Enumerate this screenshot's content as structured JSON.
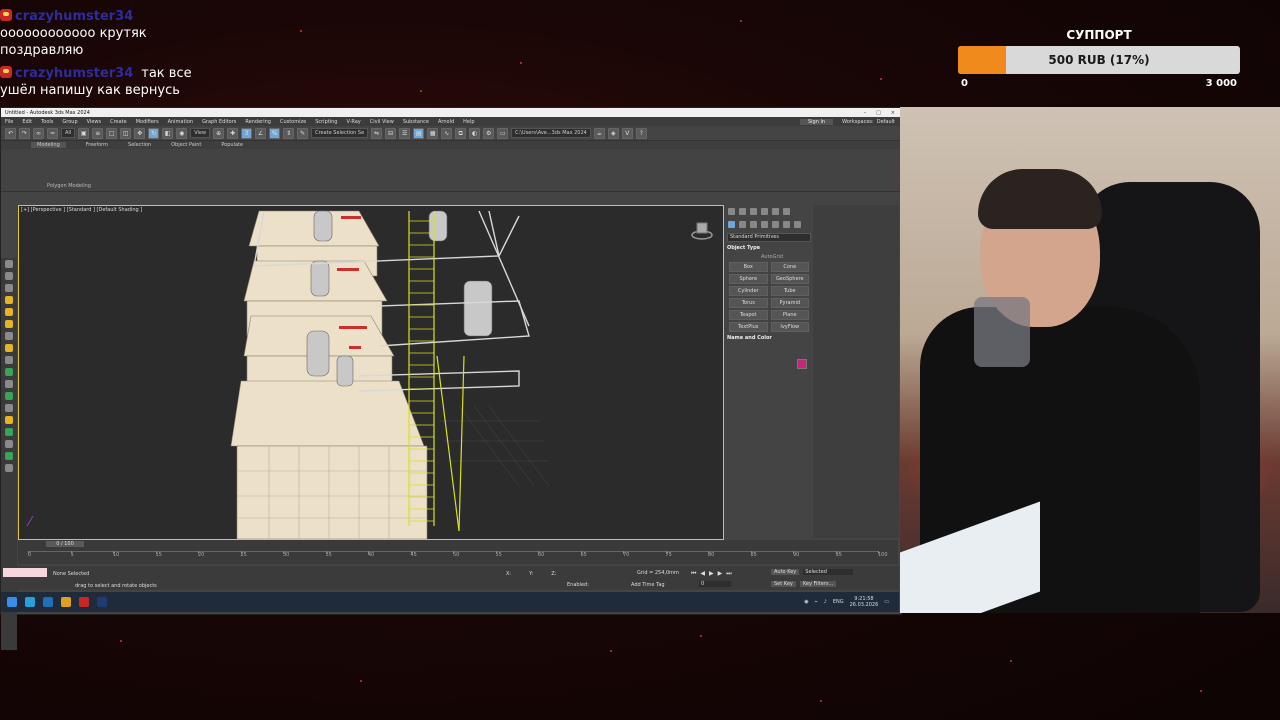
{
  "chat": [
    {
      "user": "crazyhumster34",
      "lines": [
        "оооооооооооо крутяк",
        "поздравляю"
      ]
    },
    {
      "user": "crazyhumster34",
      "inline": "так все",
      "lines": [
        "ушёл напишу как вернусь"
      ]
    }
  ],
  "support_goal": {
    "title": "СУППОРТ",
    "label": "500 RUB (17%)",
    "progress": 0.17,
    "min": "0",
    "max": "3 000",
    "fill_color": "#f08a1c"
  },
  "app": {
    "title": "Untitled - Autodesk 3ds Max 2024",
    "menu": [
      "File",
      "Edit",
      "Tools",
      "Group",
      "Views",
      "Create",
      "Modifiers",
      "Animation",
      "Graph Editors",
      "Rendering",
      "Customize",
      "Scripting",
      "V-Ray",
      "Civil View",
      "Substance",
      "Arnold",
      "Help"
    ],
    "sign_in": "Sign In",
    "workspaces_label": "Workspaces:",
    "workspace": "Default",
    "toolbar": {
      "filter": "All",
      "view": "View",
      "selection_set": "Create Selection Se",
      "path": "C:\\Users\\Ave...3ds Max 2024"
    },
    "ribbon_tabs": [
      "Modeling",
      "Freeform",
      "Selection",
      "Object Paint",
      "Populate"
    ],
    "ribbon_label": "Polygon Modeling",
    "viewport_label": "[+] [Perspective ] [Standard ] [Default Shading ]",
    "command_panel": {
      "category": "Standard Primitives",
      "object_type_title": "Object Type",
      "autogrid": "AutoGrid",
      "buttons": [
        "Box",
        "Cone",
        "Sphere",
        "GeoSphere",
        "Cylinder",
        "Tube",
        "Torus",
        "Pyramid",
        "Teapot",
        "Plane",
        "TextPlus",
        "IvyFlow"
      ],
      "name_color_title": "Name and Color",
      "swatch_color": "#c4267a"
    },
    "timeline": {
      "slider": "0 / 100",
      "ticks": [
        "0",
        "5",
        "10",
        "15",
        "20",
        "25",
        "30",
        "35",
        "40",
        "45",
        "50",
        "55",
        "60",
        "65",
        "70",
        "75",
        "80",
        "85",
        "90",
        "95",
        "100"
      ]
    },
    "status": {
      "selection": "None Selected",
      "prompt": "drag to select and rotate objects",
      "x": "X:",
      "y": "Y:",
      "z": "Z:",
      "grid": "Grid = 254,0mm",
      "enabled": "Enabled:",
      "add_time_tag": "Add Time Tag",
      "auto_key": "Auto Key",
      "selected": "Selected",
      "set_key": "Set Key",
      "key_filters": "Key Filters...",
      "frame": "0"
    },
    "taskbar": {
      "lang": "ENG",
      "time": "9:21:58",
      "date": "26.03.2026"
    }
  }
}
